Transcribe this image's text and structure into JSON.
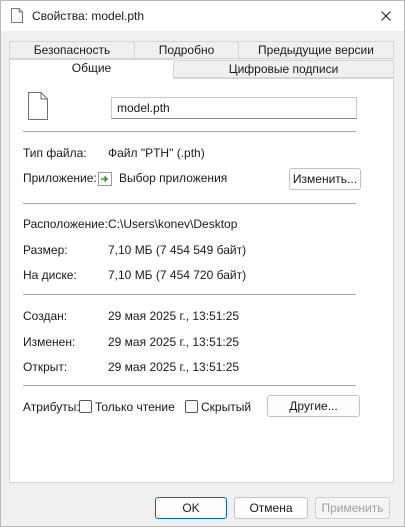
{
  "window": {
    "title": "Свойства: model.pth",
    "close_icon": "close-icon"
  },
  "tabs": {
    "row_back": [
      "Безопасность",
      "Подробно",
      "Предыдущие версии"
    ],
    "row_front": [
      "Общие",
      "Цифровые подписи"
    ],
    "active": "Общие"
  },
  "general": {
    "file_name": "model.pth",
    "file_type_label": "Тип файла:",
    "file_type_value": "Файл \"PTH\" (.pth)",
    "opens_with_label": "Приложение:",
    "opens_with_value": "Выбор приложения",
    "change_button": "Изменить...",
    "location_label": "Расположение:",
    "location_value": "C:\\Users\\konev\\Desktop",
    "size_label": "Размер:",
    "size_value": "7,10 МБ (7 454 549 байт)",
    "size_on_disk_label": "На диске:",
    "size_on_disk_value": "7,10 МБ (7 454 720 байт)",
    "created_label": "Создан:",
    "created_value": "29 мая 2025 г., 13:51:25",
    "modified_label": "Изменен:",
    "modified_value": "29 мая 2025 г., 13:51:25",
    "accessed_label": "Открыт:",
    "accessed_value": "29 мая 2025 г., 13:51:25",
    "attributes_label": "Атрибуты:",
    "readonly_label": "Только чтение",
    "readonly_checked": false,
    "hidden_label": "Скрытый",
    "hidden_checked": false,
    "advanced_button": "Другие..."
  },
  "footer": {
    "ok": "OK",
    "cancel": "Отмена",
    "apply": "Применить"
  },
  "colors": {
    "accent": "#0067c0",
    "app_icon_green": "#2e9a3e"
  }
}
